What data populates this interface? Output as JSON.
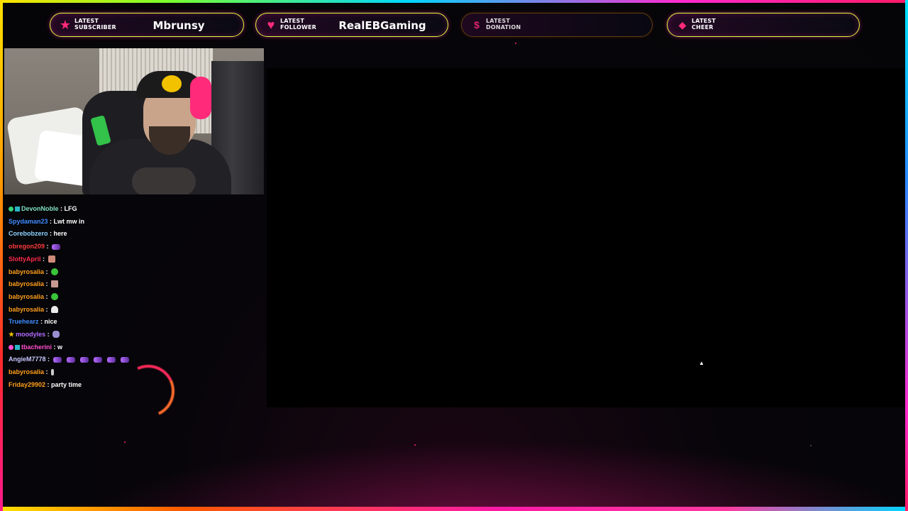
{
  "alerts": [
    {
      "label": "LATEST\nSUBSCRIBER",
      "value": "Mbrunsy",
      "icon": "star-icon"
    },
    {
      "label": "LATEST\nFOLLOWER",
      "value": "RealEBGaming",
      "icon": "heart-icon"
    },
    {
      "label": "LATEST\nDONATION",
      "value": "",
      "icon": "dollar-icon"
    },
    {
      "label": "LATEST\nCHEER",
      "value": "",
      "icon": "diamond-icon"
    }
  ],
  "chat": [
    {
      "user": "DevonNoble",
      "color": "#7fe0c0",
      "msg": "LFG",
      "badges": [
        "green",
        "teal"
      ]
    },
    {
      "user": "Spydaman23",
      "color": "#3f8cff",
      "msg": "Lwt mw in"
    },
    {
      "user": "Corebobzero",
      "color": "#8fd4ff",
      "msg": "here"
    },
    {
      "user": "obregon209",
      "color": "#ff3a3a",
      "msg": "",
      "emote": "bow"
    },
    {
      "user": "SlottyApril",
      "color": "#ff2a4a",
      "msg": "",
      "emote": "face"
    },
    {
      "user": "babyrosalia",
      "color": "#ff9f1a",
      "msg": "",
      "emote": "blob"
    },
    {
      "user": "babyrosalia",
      "color": "#ff9f1a",
      "msg": "",
      "emote": "pic"
    },
    {
      "user": "babyrosalia",
      "color": "#ff9f1a",
      "msg": "",
      "emote": "blob"
    },
    {
      "user": "babyrosalia",
      "color": "#ff9f1a",
      "msg": "",
      "emote": "ghost"
    },
    {
      "user": "Truehearz",
      "color": "#3f8cff",
      "msg": "nice"
    },
    {
      "user": "moodyles",
      "color": "#b46bff",
      "msg": "",
      "badges": [
        "gold"
      ],
      "emote": "owl"
    },
    {
      "user": "tbacherini",
      "color": "#ff4fd0",
      "msg": "w",
      "badges": [
        "pink",
        "teal"
      ]
    },
    {
      "user": "AngieM7778",
      "color": "#c8c8ff",
      "msg": "",
      "emote": "bow",
      "emote_count": 6
    },
    {
      "user": "babyrosalia",
      "color": "#ff9f1a",
      "msg": "",
      "emote": "mini"
    },
    {
      "user": "Friday29902",
      "color": "#ff9f1a",
      "msg": "party time"
    }
  ],
  "theme": {
    "accent": "#ff2a7a",
    "alert_border": "#d9ff3a"
  }
}
